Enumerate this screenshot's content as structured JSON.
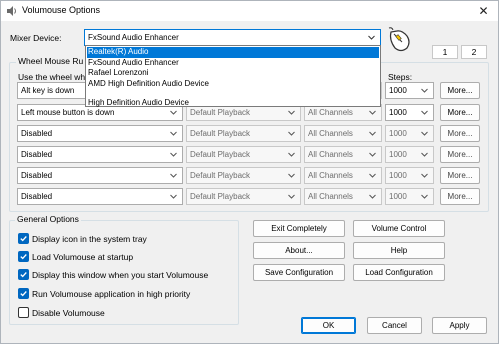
{
  "window": {
    "title": "Volumouse Options",
    "close": "✕"
  },
  "mixer": {
    "label": "Mixer Device:",
    "selected": "FxSound Audio Enhancer",
    "options": [
      "Realtek(R) Audio",
      "FxSound Audio Enhancer",
      "Rafael Lorenzoni",
      "AMD High Definition Audio Device",
      "",
      "High Definition Audio Device"
    ],
    "highlighted_index": 0
  },
  "tabs": [
    "1",
    "2"
  ],
  "rules": {
    "group_title": "Wheel Mouse Ru",
    "use_wheel_label": "Use the wheel wh",
    "steps_label": "Steps:",
    "more_label": "More...",
    "rows": [
      {
        "condition": "Alt key is down",
        "target": "Default Playback",
        "channels": "All Channels",
        "steps": "1000",
        "enabled": true
      },
      {
        "condition": "Left mouse button is down",
        "target": "Default Playback",
        "channels": "All Channels",
        "steps": "1000",
        "enabled": true
      },
      {
        "condition": "Disabled",
        "target": "Default Playback",
        "channels": "All Channels",
        "steps": "1000",
        "enabled": false
      },
      {
        "condition": "Disabled",
        "target": "Default Playback",
        "channels": "All Channels",
        "steps": "1000",
        "enabled": false
      },
      {
        "condition": "Disabled",
        "target": "Default Playback",
        "channels": "All Channels",
        "steps": "1000",
        "enabled": false
      },
      {
        "condition": "Disabled",
        "target": "Default Playback",
        "channels": "All Channels",
        "steps": "1000",
        "enabled": false
      }
    ]
  },
  "general": {
    "title": "General Options",
    "options": [
      {
        "label": "Display icon in the system tray",
        "checked": true
      },
      {
        "label": "Load Volumouse at startup",
        "checked": true
      },
      {
        "label": "Display this window when you start Volumouse",
        "checked": true
      },
      {
        "label": "Run Volumouse application in high priority",
        "checked": true
      },
      {
        "label": "Disable Volumouse",
        "checked": false
      }
    ]
  },
  "actions": {
    "exit": "Exit Completely",
    "volume_control": "Volume Control",
    "about": "About...",
    "help": "Help",
    "save_config": "Save Configuration",
    "load_config": "Load Configuration"
  },
  "footer": {
    "ok": "OK",
    "cancel": "Cancel",
    "apply": "Apply"
  },
  "colors": {
    "accent": "#0078d7",
    "check_blue": "#0067c0"
  },
  "icons": {
    "app": "speaker-icon",
    "mouse": "mouse-wheel-icon",
    "chevron": "chevron-down-icon"
  }
}
